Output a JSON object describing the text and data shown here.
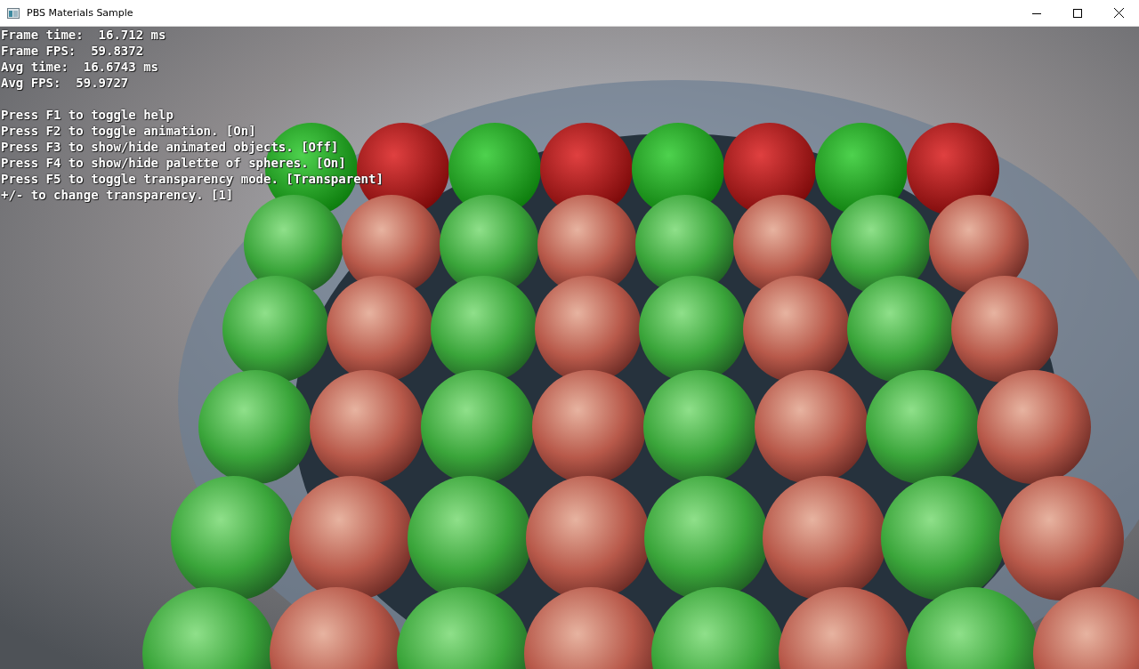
{
  "window": {
    "title": "PBS Materials Sample"
  },
  "stats_lines": [
    "Frame time:  16.712 ms",
    "Frame FPS:  59.8372",
    "Avg time:  16.6743 ms",
    "Avg FPS:  59.9727"
  ],
  "help_lines": [
    "Press F1 to toggle help",
    "Press F2 to toggle animation. [On]",
    "Press F3 to show/hide animated objects. [Off]",
    "Press F4 to show/hide palette of spheres. [On]",
    "Press F5 to toggle transparency mode. [Transparent]",
    "+/- to change transparency. [1]"
  ]
}
